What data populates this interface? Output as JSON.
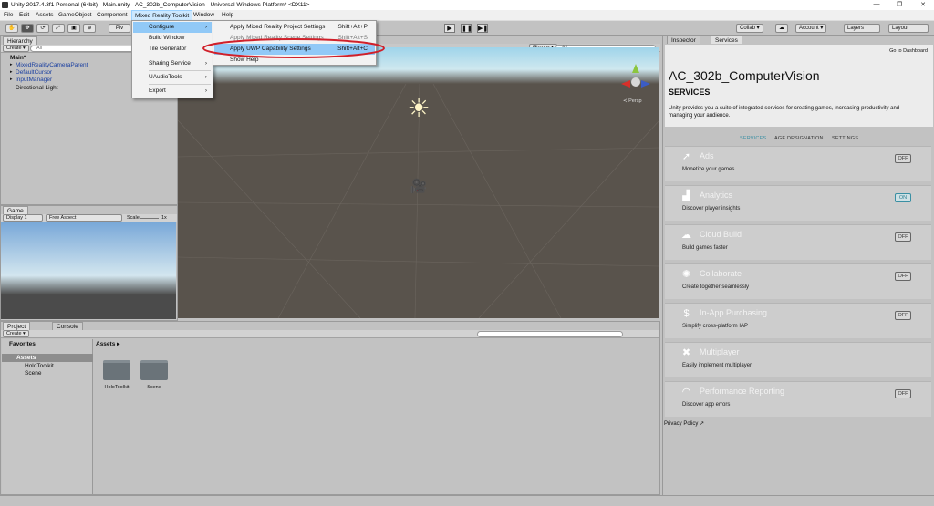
{
  "window": {
    "title": "Unity 2017.4.3f1 Personal (64bit) - Main.unity - AC_302b_ComputerVision - Universal Windows Platform* <DX11>",
    "controls": [
      "—",
      "❐",
      "✕"
    ]
  },
  "menubar": {
    "items": [
      "File",
      "Edit",
      "Assets",
      "GameObject",
      "Component",
      "Mixed Reality Toolkit",
      "Window",
      "Help"
    ]
  },
  "toolbar": {
    "pivot_label": "Piv",
    "play_icons": [
      "▶",
      "❚❚",
      "▶❚"
    ],
    "collab_label": "Collab ▾",
    "account_label": "Account ▾",
    "layers_label": "Layers",
    "layout_label": "Layout"
  },
  "mrtk_menu": {
    "items": [
      {
        "label": "Configure",
        "has_submenu": true,
        "highlighted": true
      },
      {
        "label": "Build Window",
        "has_submenu": false
      },
      {
        "label": "Tile Generator",
        "has_submenu": false
      },
      {
        "label": "Sharing Service",
        "has_submenu": true
      },
      {
        "label": "UAudioTools",
        "has_submenu": true
      },
      {
        "label": "Export",
        "has_submenu": true
      }
    ]
  },
  "configure_submenu": {
    "items": [
      {
        "label": "Apply Mixed Reality Project Settings",
        "shortcut": "Shift+Alt+P"
      },
      {
        "label": "Apply Mixed Reality Scene Settings",
        "shortcut": "Shift+Alt+S"
      },
      {
        "label": "Apply UWP Capability Settings",
        "shortcut": "Shift+Alt+C",
        "highlighted": true
      },
      {
        "label": "Show Help",
        "shortcut": ""
      }
    ],
    "highlight_color": "#d0202a"
  },
  "hierarchy": {
    "tab_label": "Hierarchy",
    "create_label": "Create ▾",
    "search_placeholder": "All",
    "scene_name": "Main*",
    "items": [
      "MixedRealityCameraParent",
      "DefaultCursor",
      "InputManager",
      "Directional Light"
    ]
  },
  "scene": {
    "gizmos_label": "Gizmos ▾",
    "search_placeholder": "All",
    "persp_label": "≺ Persp"
  },
  "game": {
    "tab_label": "Game",
    "display_label": "Display 1",
    "aspect_label": "Free Aspect",
    "scale_label": "Scale",
    "scale_value": "1x"
  },
  "project": {
    "tabs": [
      "Project",
      "Console"
    ],
    "create_label": "Create ▾",
    "favorites_label": "Favorites",
    "assets_label": "Assets",
    "tree": [
      "HoloToolkit",
      "Scene"
    ],
    "breadcrumb": "Assets ▸",
    "folders": [
      "HoloToolkit",
      "Scene"
    ]
  },
  "inspector": {
    "tabs": [
      "Inspector",
      "Services"
    ],
    "go_dashboard": "Go to Dashboard",
    "project_name": "AC_302b_ComputerVision",
    "heading": "SERVICES",
    "intro": "Unity provides you a suite of integrated services for creating games, increasing productivity and managing your audience.",
    "service_tabs": [
      "SERVICES",
      "AGE DESIGNATION",
      "SETTINGS"
    ],
    "services": [
      {
        "icon": "ads-icon",
        "glyph": "➚",
        "name": "Ads",
        "desc": "Monetize your games",
        "state": "OFF"
      },
      {
        "icon": "analytics-icon",
        "glyph": "▟",
        "name": "Analytics",
        "desc": "Discover player insights",
        "state": "ON"
      },
      {
        "icon": "cloud-build-icon",
        "glyph": "☁",
        "name": "Cloud Build",
        "desc": "Build games faster",
        "state": "OFF"
      },
      {
        "icon": "collaborate-icon",
        "glyph": "✺",
        "name": "Collaborate",
        "desc": "Create together seamlessly",
        "state": "OFF"
      },
      {
        "icon": "iap-icon",
        "glyph": "$",
        "name": "In-App Purchasing",
        "desc": "Simplify cross-platform IAP",
        "state": "OFF"
      },
      {
        "icon": "multiplayer-icon",
        "glyph": "✖",
        "name": "Multiplayer",
        "desc": "Easily implement multiplayer",
        "state": ""
      },
      {
        "icon": "performance-icon",
        "glyph": "◠",
        "name": "Performance Reporting",
        "desc": "Discover app errors",
        "state": "OFF"
      }
    ],
    "privacy_label": "Privacy Policy ↗"
  }
}
